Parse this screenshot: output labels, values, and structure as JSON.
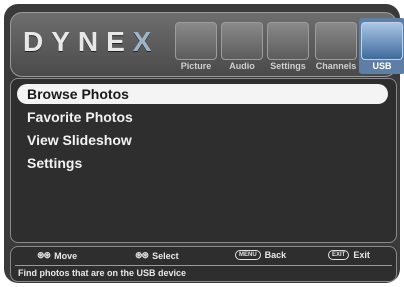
{
  "brand": {
    "logo_text": "DYNE",
    "logo_x": "X"
  },
  "tabs": [
    {
      "label": "Picture",
      "icon": "picture-icon"
    },
    {
      "label": "Audio",
      "icon": "audio-icon"
    },
    {
      "label": "Settings",
      "icon": "settings-icon"
    },
    {
      "label": "Channels",
      "icon": "channels-icon"
    },
    {
      "label": "USB",
      "icon": "usb-icon",
      "selected": true
    }
  ],
  "menu": {
    "items": [
      {
        "label": "Browse Photos",
        "selected": true
      },
      {
        "label": "Favorite Photos"
      },
      {
        "label": "View Slideshow"
      },
      {
        "label": "Settings"
      }
    ]
  },
  "footer": {
    "hints": [
      {
        "key": "⊛⊛",
        "label": "Move"
      },
      {
        "key": "⊛⊛",
        "label": "Select"
      },
      {
        "key": "MENU",
        "label": "Back"
      },
      {
        "key": "EXIT",
        "label": "Exit"
      }
    ],
    "description": "Find photos that are on the USB device"
  },
  "colors": {
    "screen_bg": "#3a3a3a",
    "selected_item_bg": "#f4f4f4",
    "selected_tab_bg": "#5e7ea6"
  }
}
